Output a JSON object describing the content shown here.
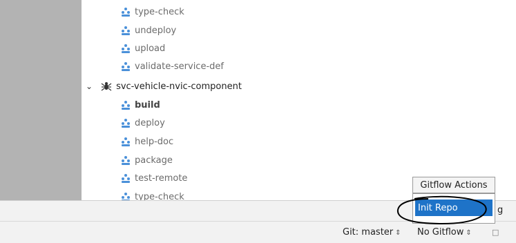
{
  "tree": {
    "tasks_top": [
      "type-check",
      "undeploy",
      "upload",
      "validate-service-def"
    ],
    "project": "svc-vehicle-nvic-component",
    "tasks_bottom": [
      "build",
      "deploy",
      "help-doc",
      "package",
      "test-remote",
      "type-check"
    ]
  },
  "gitflow_menu": {
    "title": "Gitflow Actions",
    "item": "Init Repo"
  },
  "toolstrip": {
    "trailing_text": "g"
  },
  "status": {
    "git_branch": "Git: master",
    "gitflow": "No Gitflow"
  },
  "colors": {
    "highlight": "#1e73c8",
    "task_icon": "#4a90d9"
  },
  "icons": {
    "task": "task-people-icon",
    "project": "spider-project-icon",
    "expand": "chevron-down-icon",
    "lock": "lock-icon"
  }
}
